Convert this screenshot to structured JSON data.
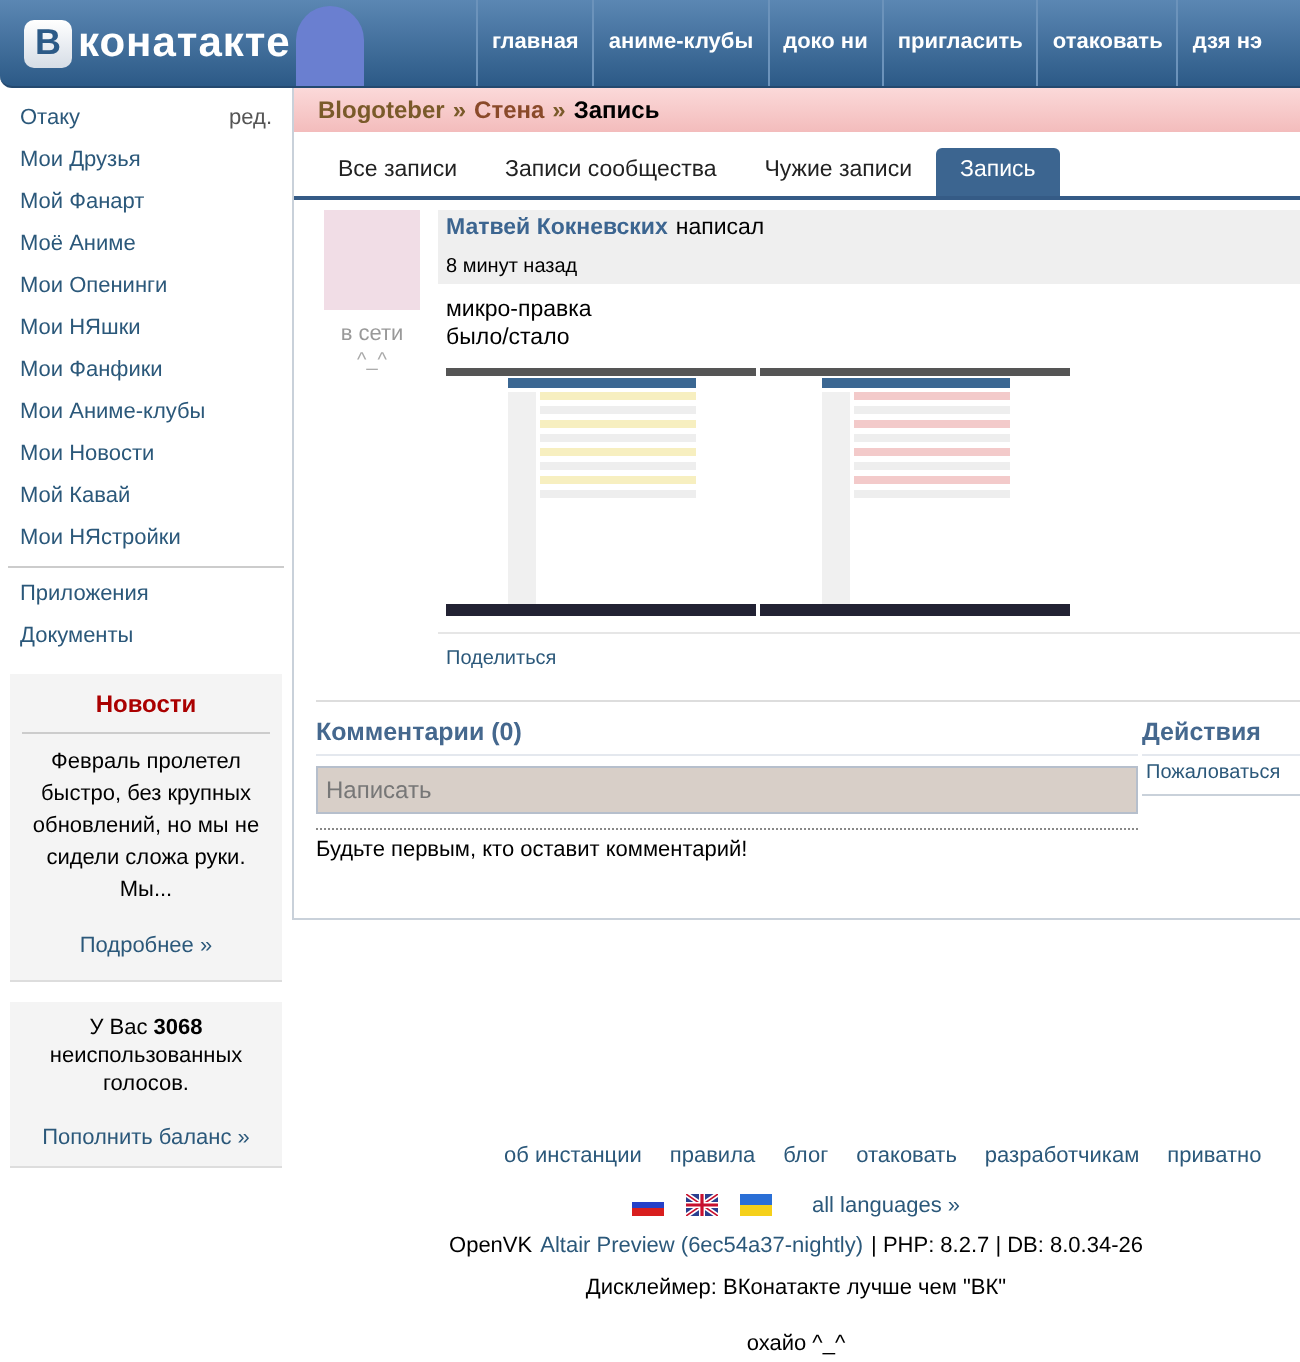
{
  "header": {
    "logo_letter": "В",
    "logo_text": "конатакте",
    "nav": [
      {
        "label": "главная"
      },
      {
        "label": "аниме-клубы"
      },
      {
        "label": "доко ни"
      },
      {
        "label": "пригласить"
      },
      {
        "label": "отаковать"
      },
      {
        "label": "дзя нэ"
      }
    ]
  },
  "sidebar": {
    "profile": {
      "label": "Отаку",
      "edit": "ред."
    },
    "items": [
      {
        "label": "Мои Друзья"
      },
      {
        "label": "Мой Фанарт"
      },
      {
        "label": "Моё Аниме"
      },
      {
        "label": "Мои Опенинги"
      },
      {
        "label": "Мои НЯшки"
      },
      {
        "label": "Мои Фанфики"
      },
      {
        "label": "Мои Аниме-клубы"
      },
      {
        "label": "Мои Новости"
      },
      {
        "label": "Мой Кавай"
      },
      {
        "label": "Мои НЯстройки"
      }
    ],
    "extra_items": [
      {
        "label": "Приложения"
      },
      {
        "label": "Документы"
      }
    ],
    "news": {
      "title": "Новости",
      "text": "Февраль пролетел быстро, без крупных обновлений, но мы не сидели сложа руки. Мы...",
      "link": "Подробнее »"
    },
    "votes": {
      "text": "У Вас **3068** неиспользованных голосов.",
      "link": "Пополнить баланс »"
    }
  },
  "breadcrumb": [
    {
      "label": "Blogoteber",
      "kind": "link"
    },
    {
      "label": "»",
      "kind": "sep"
    },
    {
      "label": "Стена",
      "kind": "link"
    },
    {
      "label": "»",
      "kind": "sep"
    },
    {
      "label": "Запись",
      "kind": "current"
    }
  ],
  "tabs": [
    {
      "label": "Все записи",
      "selected": false
    },
    {
      "label": "Записи сообщества",
      "selected": false
    },
    {
      "label": "Чужие записи",
      "selected": false
    },
    {
      "label": "Запись",
      "selected": true
    }
  ],
  "post": {
    "author": "Матвей Кокневских",
    "action": "написал",
    "time": "8 минут назад",
    "status": "в сети",
    "status_face": "^_^",
    "lines": [
      "микро-правка",
      "было/стало"
    ],
    "images": [
      {
        "kind": "before"
      },
      {
        "kind": "after"
      }
    ],
    "share": "Поделиться"
  },
  "comments": {
    "title": "Комментарии (0)",
    "placeholder": "Написать",
    "empty": "Будьте первым, кто оставит комментарий!"
  },
  "actions": {
    "title": "Действия",
    "items": [
      "Пожаловаться"
    ]
  },
  "footer": {
    "links": [
      "об инстанции",
      "правила",
      "блог",
      "отаковать",
      "разработчикам",
      "приватно"
    ],
    "languages": [
      {
        "kind": "ru"
      },
      {
        "kind": "gb"
      },
      {
        "kind": "ua"
      }
    ],
    "all_languages": "all languages »",
    "brand": "OpenVK",
    "version": "Altair Preview (6ec54a37-nightly)",
    "tech": "| PHP: 8.2.7 | DB: 8.0.34-26",
    "disclaimer": "Дисклеймер: ВКонатакте лучше чем \"ВК\"",
    "greeting": "охайо ^_^"
  }
}
